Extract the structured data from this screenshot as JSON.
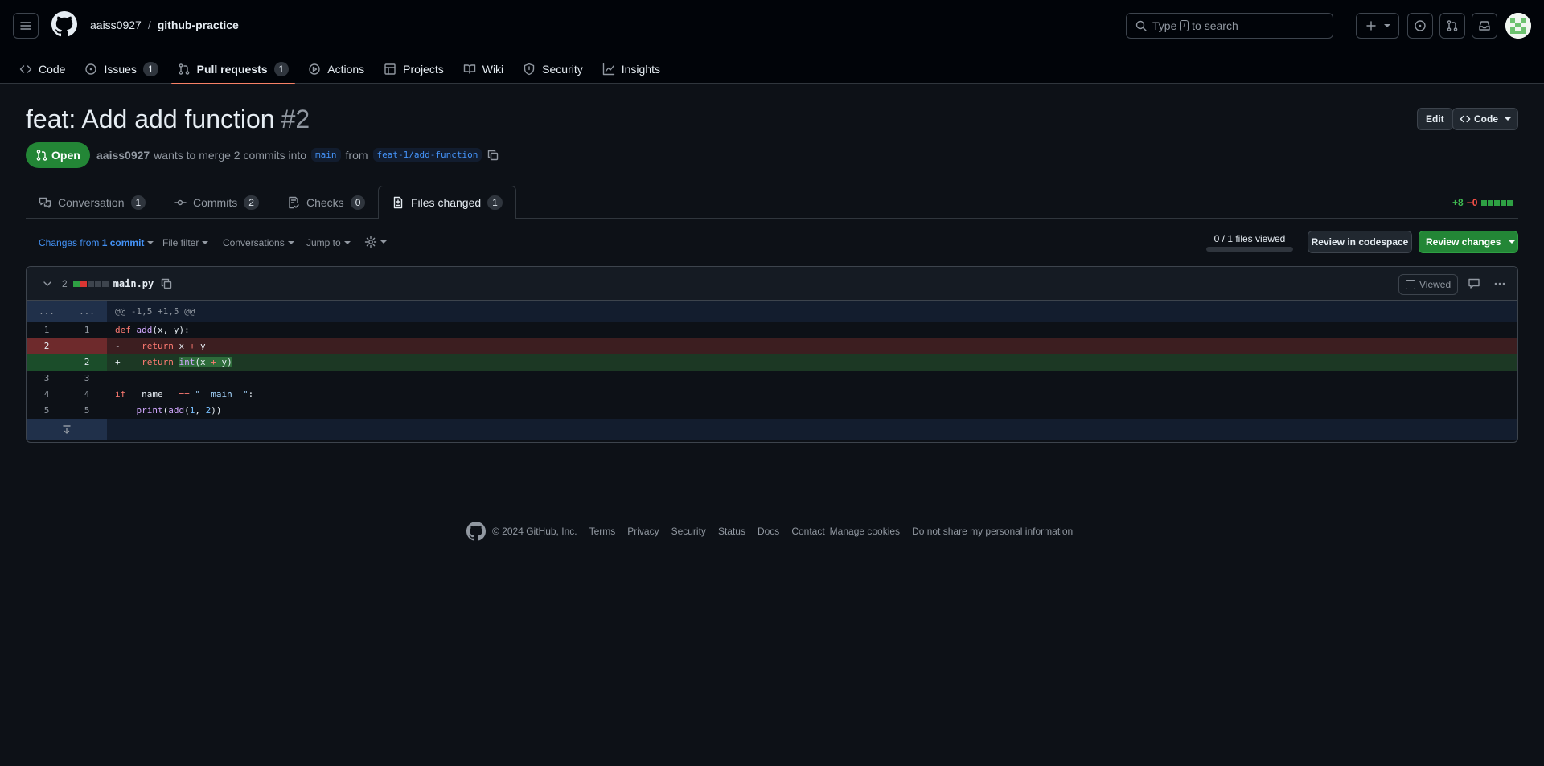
{
  "header": {
    "owner": "aaiss0927",
    "separator": "/",
    "repo": "github-practice",
    "search_prefix": "Type",
    "search_key": "/",
    "search_suffix": "to search"
  },
  "repo_nav": [
    {
      "label": "Code",
      "count": null
    },
    {
      "label": "Issues",
      "count": "1"
    },
    {
      "label": "Pull requests",
      "count": "1"
    },
    {
      "label": "Actions",
      "count": null
    },
    {
      "label": "Projects",
      "count": null
    },
    {
      "label": "Wiki",
      "count": null
    },
    {
      "label": "Security",
      "count": null
    },
    {
      "label": "Insights",
      "count": null
    }
  ],
  "pr": {
    "title": "feat: Add add function",
    "number": "#2",
    "edit_label": "Edit",
    "code_label": "Code",
    "state": "Open",
    "author": "aaiss0927",
    "merge_text": "wants to merge 2 commits into",
    "base_branch": "main",
    "from_text": "from",
    "head_branch": "feat-1/add-function"
  },
  "tabs": [
    {
      "label": "Conversation",
      "count": "1"
    },
    {
      "label": "Commits",
      "count": "2"
    },
    {
      "label": "Checks",
      "count": "0"
    },
    {
      "label": "Files changed",
      "count": "1"
    }
  ],
  "diffstat": {
    "additions": "+8",
    "deletions": "−0"
  },
  "toolbar": {
    "changes_from": "Changes from",
    "commit_link": "1 commit",
    "file_filter": "File filter",
    "conversations": "Conversations",
    "jump_to": "Jump to",
    "files_viewed": "0 / 1 files viewed",
    "files_viewed_fraction": 0,
    "review_codespace": "Review in codespace",
    "review_changes": "Review changes"
  },
  "file": {
    "changes": "2",
    "name": "main.py",
    "viewed_label": "Viewed",
    "hunk_header": "@@ -1,5 +1,5 @@",
    "hunk_dots": "...",
    "lines": [
      {
        "type": "ctx",
        "old": "1",
        "new": "1",
        "sign": "",
        "code": "def add(x, y):"
      },
      {
        "type": "del",
        "old": "2",
        "new": "",
        "sign": "-",
        "code": "    return x + y"
      },
      {
        "type": "add",
        "old": "",
        "new": "2",
        "sign": "+",
        "code": "    return int(x + y)"
      },
      {
        "type": "ctx",
        "old": "3",
        "new": "3",
        "sign": "",
        "code": ""
      },
      {
        "type": "ctx",
        "old": "4",
        "new": "4",
        "sign": "",
        "code": "if __name__ == \"__main__\":"
      },
      {
        "type": "ctx",
        "old": "5",
        "new": "5",
        "sign": "",
        "code": "    print(add(1, 2))"
      }
    ]
  },
  "footer": {
    "copyright": "© 2024 GitHub, Inc.",
    "links": [
      "Terms",
      "Privacy",
      "Security",
      "Status",
      "Docs",
      "Contact",
      "Manage cookies",
      "Do not share my personal information"
    ]
  }
}
